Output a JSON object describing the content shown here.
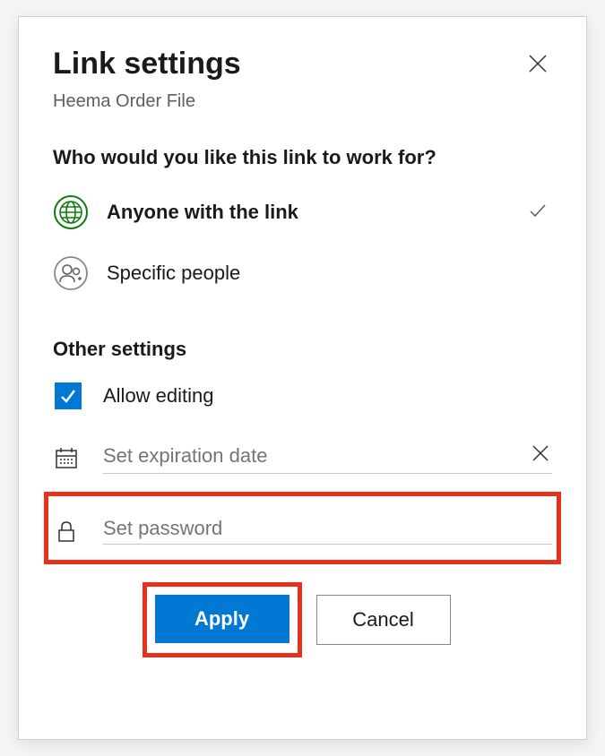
{
  "header": {
    "title": "Link settings",
    "subtitle": "Heema Order File"
  },
  "question": "Who would you like this link to work for?",
  "options": {
    "anyone": "Anyone with the link",
    "specific": "Specific people"
  },
  "otherSettings": {
    "title": "Other settings",
    "allowEditing": "Allow editing",
    "expiration_placeholder": "Set expiration date",
    "password_placeholder": "Set password"
  },
  "actions": {
    "apply": "Apply",
    "cancel": "Cancel"
  },
  "colors": {
    "primary": "#0078d4",
    "highlight": "#e8311a",
    "globe": "#107c10"
  }
}
